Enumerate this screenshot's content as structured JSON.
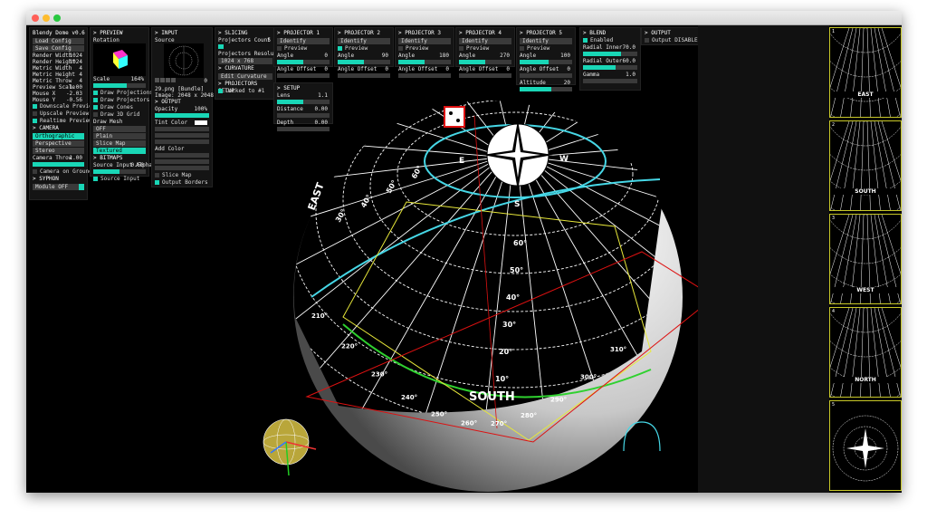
{
  "window": {
    "traffic": [
      "#ff5f57",
      "#febc2e",
      "#28c840"
    ]
  },
  "col1": {
    "title": "Blendy Dome v0.6",
    "load": "Load Config",
    "save": "Save Config",
    "rows": [
      {
        "label": "Render Width",
        "value": "1024"
      },
      {
        "label": "Render Height",
        "value": "1024"
      },
      {
        "label": "Metric Width",
        "value": "4"
      },
      {
        "label": "Metric Height",
        "value": "4"
      },
      {
        "label": "Metric Throw",
        "value": "4"
      },
      {
        "label": "Preview Scale",
        "value": "1.00"
      },
      {
        "label": "Mouse X",
        "value": "-2.03"
      },
      {
        "label": "Mouse Y",
        "value": "-0.56"
      }
    ],
    "checks": [
      {
        "label": "Downscale Preview",
        "on": true
      },
      {
        "label": "Upscale Preview",
        "on": false
      },
      {
        "label": "Realtime Preview",
        "on": true
      }
    ],
    "camera_title": "> CAMERA",
    "camera_opts": [
      {
        "label": "Orthographic",
        "sel": true
      },
      {
        "label": "Perspective",
        "sel": false
      },
      {
        "label": "Stereo",
        "sel": false
      }
    ],
    "camera_throw_label": "Camera Throw",
    "camera_throw_value": "1.00",
    "camera_ground": "Camera on Ground",
    "syphon_title": "> SYPHON",
    "syphon_value": "Module OFF"
  },
  "col2": {
    "title": "> PREVIEW",
    "rotation": "Rotation",
    "scale_label": "Scale",
    "scale_value": "164%",
    "checks": [
      {
        "label": "Draw Projections",
        "on": true
      },
      {
        "label": "Draw Projectors",
        "on": true
      },
      {
        "label": "Draw Cones",
        "on": true
      },
      {
        "label": "Draw 3D Grid",
        "on": false
      }
    ],
    "mesh_title": "Draw Mesh",
    "mesh_opts": [
      {
        "label": "OFF",
        "sel": false
      },
      {
        "label": "Plain",
        "sel": false
      },
      {
        "label": "Slice Map",
        "sel": false
      },
      {
        "label": "Textured",
        "sel": true
      }
    ],
    "bitmaps_title": "> BITMAPS",
    "alpha_label": "Source Input Alpha",
    "alpha_value": "0.50",
    "source_input": "Source Input"
  },
  "col3": {
    "title": "> INPUT",
    "source": "Source",
    "zero": "0",
    "file": "29.png [Bundle]",
    "image": "Image: 2048 x 2048 RGBA",
    "output_title": "> OUTPUT",
    "opacity_label": "Opacity",
    "opacity_value": "100%",
    "tint": "Tint Color",
    "add": "Add Color",
    "slice_map": "Slice Map",
    "borders": "Output Borders"
  },
  "col4": {
    "title": "> SLICING",
    "count_label": "Projectors Count",
    "count_value": "5",
    "res_label": "Projectors Resolution",
    "res_value": "1024 x 768",
    "curv_title": "> CURVATURE",
    "curv_btn": "Edit Curvature",
    "setup_title": "> PROJECTORS SETUP",
    "locked": "Locked to #1"
  },
  "projectors": [
    {
      "title": "> PROJECTOR 1",
      "angle": "0",
      "offset": "0"
    },
    {
      "title": "> PROJECTOR 2",
      "angle": "90",
      "offset": "0"
    },
    {
      "title": "> PROJECTOR 3",
      "angle": "180",
      "offset": "0"
    },
    {
      "title": "> PROJECTOR 4",
      "angle": "270",
      "offset": "0"
    },
    {
      "title": "> PROJECTOR 5",
      "angle": "100",
      "offset": "0"
    }
  ],
  "proj_labels": {
    "identify": "Identify",
    "preview": "Preview",
    "angle": "Angle",
    "offset": "Angle Offset",
    "altitude": "Altitude",
    "altitude_value": "20"
  },
  "setup": {
    "title": "> SETUP",
    "lens_label": "Lens",
    "lens_value": "1.1",
    "distance_label": "Distance",
    "distance_value": "0.00",
    "depth_label": "Depth",
    "depth_value": "0.00"
  },
  "blend": {
    "title": "> BLEND",
    "enabled": "Enabled",
    "inner_label": "Radial Inner",
    "inner_value": "70.0",
    "outer_label": "Radial Outer",
    "outer_value": "60.0",
    "gamma_label": "Gamma",
    "gamma_value": "1.0"
  },
  "output": {
    "title": "> OUTPUT",
    "disabled": "Output DISABLED"
  },
  "dome": {
    "east": "EAST",
    "south": "SOUTH",
    "compass_e": "E",
    "compass_s": "S",
    "compass_w": "W",
    "alt_labels": [
      "60°",
      "50°",
      "40°",
      "30°",
      "20°",
      "10°"
    ],
    "left_alts": [
      "60°",
      "50°",
      "40°",
      "30°"
    ],
    "azimuths": [
      "210°",
      "220°",
      "230°",
      "240°",
      "250°",
      "260°",
      "270°",
      "280°",
      "290°",
      "300°",
      "310°"
    ]
  },
  "thumbs": [
    {
      "n": "1",
      "label": "EAST"
    },
    {
      "n": "2",
      "label": "SOUTH"
    },
    {
      "n": "3",
      "label": "WEST"
    },
    {
      "n": "4",
      "label": "NORTH"
    },
    {
      "n": "5",
      "label": "N"
    }
  ],
  "colors": {
    "accent": "#19d6b6",
    "select_border": "#c8c828",
    "grid": "#ffffff",
    "cyan_ring": "#46d7e6"
  }
}
